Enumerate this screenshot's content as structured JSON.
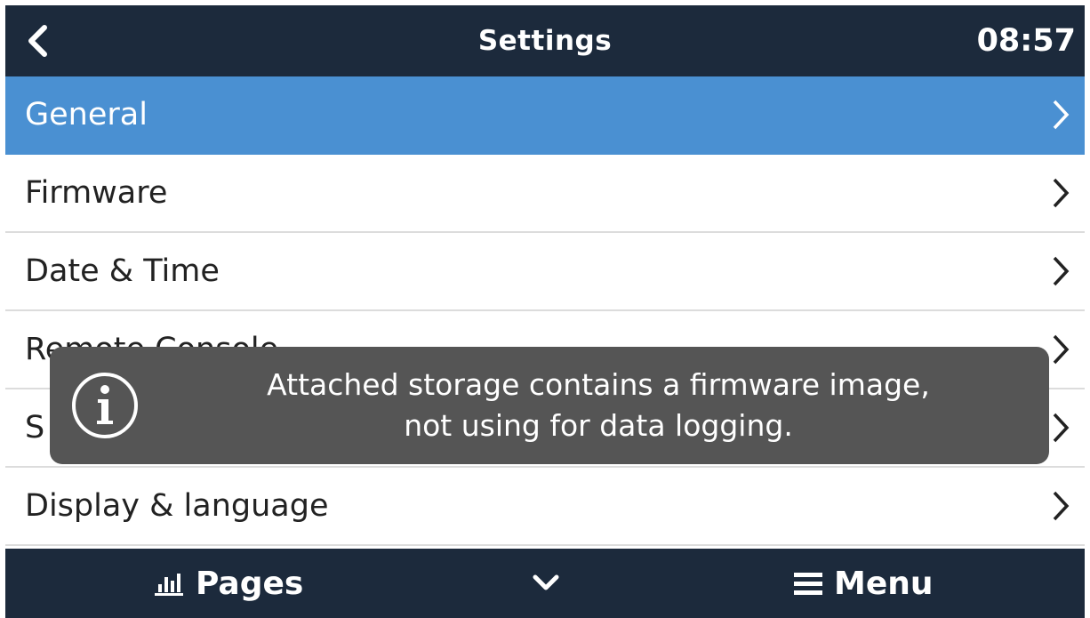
{
  "header": {
    "title": "Settings",
    "clock": "08:57",
    "back_icon": "chevron-left-icon"
  },
  "menu": {
    "items": [
      {
        "label": "General",
        "selected": true
      },
      {
        "label": "Firmware",
        "selected": false
      },
      {
        "label": "Date & Time",
        "selected": false
      },
      {
        "label": "Remote Console",
        "selected": false
      },
      {
        "label": "S",
        "selected": false
      },
      {
        "label": "Display & language",
        "selected": false
      }
    ]
  },
  "toast": {
    "line1": "Attached storage contains a firmware image,",
    "line2": "not using for data logging.",
    "icon": "info-icon"
  },
  "footer": {
    "pages_label": "Pages",
    "menu_label": "Menu",
    "pages_icon": "bar-chart-icon",
    "center_icon": "chevron-down-icon",
    "menu_icon": "hamburger-icon"
  },
  "colors": {
    "bar_background": "#1c2a3c",
    "selected_row": "#4a90d2",
    "toast_background": "#555555"
  }
}
